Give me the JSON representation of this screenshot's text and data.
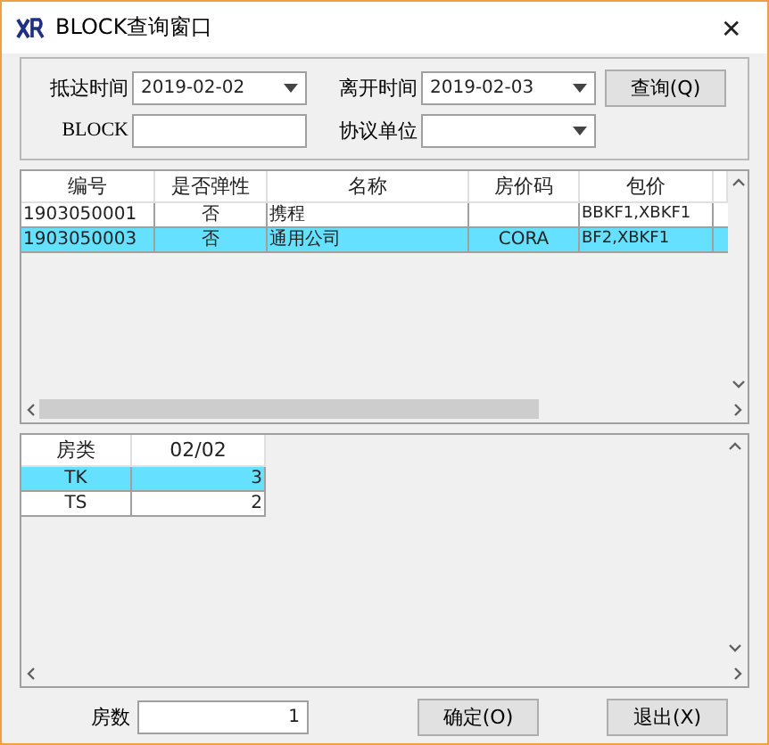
{
  "window": {
    "title": "BLOCK查询窗口",
    "close": "✕"
  },
  "filters": [
    {
      "label": "抵达时间",
      "value": "2019-02-02",
      "kind": "dropdown"
    },
    {
      "label": "离开时间",
      "value": "2019-02-03",
      "kind": "dropdown"
    },
    {
      "label": "BLOCK",
      "kind": "text"
    },
    {
      "label": "协议单位",
      "kind": "dropdown"
    }
  ],
  "query_button": "查询(Q)",
  "blocks": {
    "columns": [
      "编号",
      "是否弹性",
      "名称",
      "房价码",
      "包价"
    ],
    "rows": [
      {
        "cells": [
          "1903050001",
          "否",
          "携程",
          "",
          "BBKF1,XBKF1"
        ],
        "selected": false
      },
      {
        "cells": [
          "1903050003",
          "否",
          "通用公司",
          "CORA",
          "BF2,XBKF1"
        ],
        "selected": true
      }
    ]
  },
  "rooms": {
    "columns": [
      "房类",
      "02/02"
    ],
    "rows": [
      {
        "cells": [
          "TK",
          "3"
        ],
        "selected": true
      },
      {
        "cells": [
          "TS",
          "2"
        ],
        "selected": false
      }
    ]
  },
  "room_count": {
    "label": "房数",
    "value": "1"
  },
  "buttons": [
    "确定(O)",
    "退出(X)"
  ]
}
